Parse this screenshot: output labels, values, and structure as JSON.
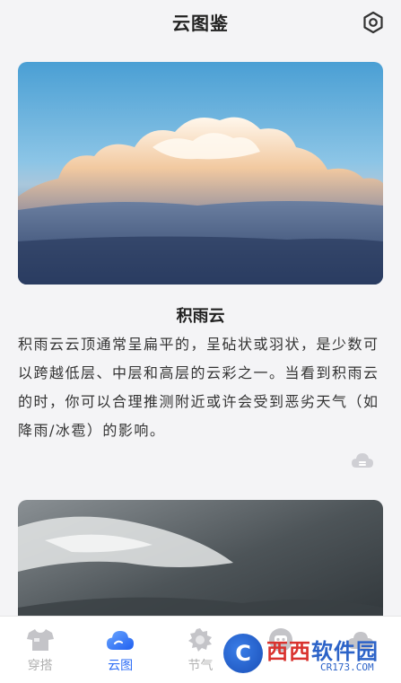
{
  "header": {
    "title": "云图鉴",
    "settings_icon": "hexagon-gear-icon"
  },
  "cards": [
    {
      "title": "积雨云",
      "description": "积雨云云顶通常呈扁平的，呈砧状或羽状，是少数可以跨越低层、中层和高层的云彩之一。当看到积雨云的时，你可以合理推测附近或许会受到恶劣天气（如降雨/冰雹）的影响。",
      "action_icon": "cloud-download-icon"
    }
  ],
  "tabbar": {
    "active_color": "#2d6df6",
    "inactive_color": "#b0b0b0",
    "items": [
      {
        "label": "穿搭",
        "icon": "shirt-icon",
        "active": false
      },
      {
        "label": "云图",
        "icon": "cloud-icon",
        "active": true
      },
      {
        "label": "节气",
        "icon": "sun-icon",
        "active": false
      },
      {
        "label": "",
        "icon": "robot-icon",
        "active": false
      },
      {
        "label": "",
        "icon": "cloud-outline-icon",
        "active": false
      }
    ]
  },
  "watermark": {
    "logo_letter": "C",
    "text_main_a": "西西",
    "text_main_b": "软件园",
    "text_sub": "CR173.COM"
  }
}
